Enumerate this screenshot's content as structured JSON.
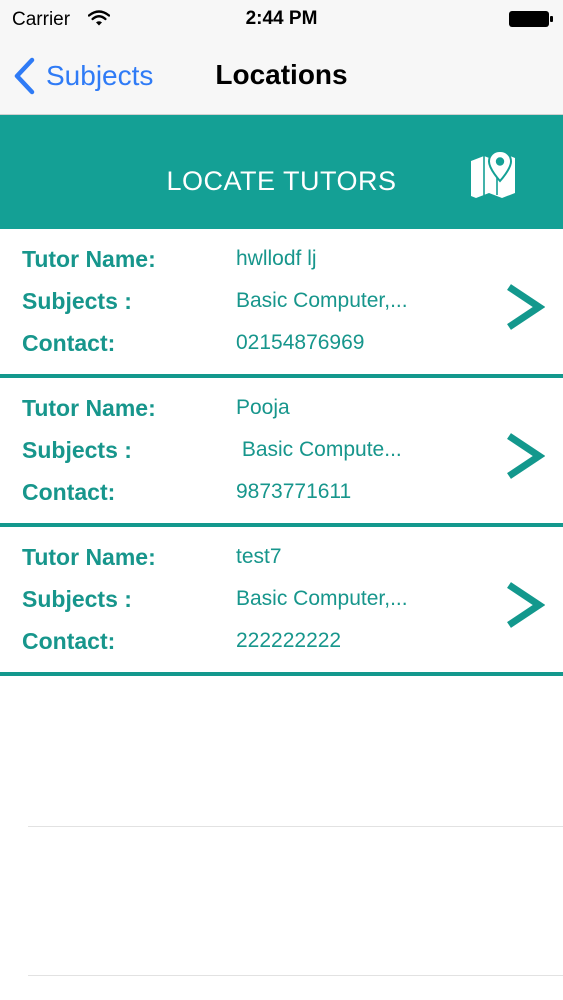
{
  "status_bar": {
    "carrier": "Carrier",
    "time": "2:44 PM"
  },
  "nav": {
    "back_label": "Subjects",
    "title": "Locations"
  },
  "header": {
    "title": "LOCATE TUTORS",
    "map_icon": "map-pin-icon"
  },
  "labels": {
    "tutor_name": "Tutor Name:",
    "subjects": "Subjects :",
    "contact": "Contact:"
  },
  "tutors": [
    {
      "name": "hwllodf lj",
      "subjects": "Basic Computer,...",
      "contact": "02154876969"
    },
    {
      "name": "Pooja",
      "subjects": " Basic Compute...",
      "contact": "9873771611"
    },
    {
      "name": "test7",
      "subjects": "Basic Computer,...",
      "contact": "222222222"
    }
  ],
  "colors": {
    "accent": "#14a095",
    "text_teal": "#17968c",
    "ios_blue": "#2f7bf6"
  }
}
